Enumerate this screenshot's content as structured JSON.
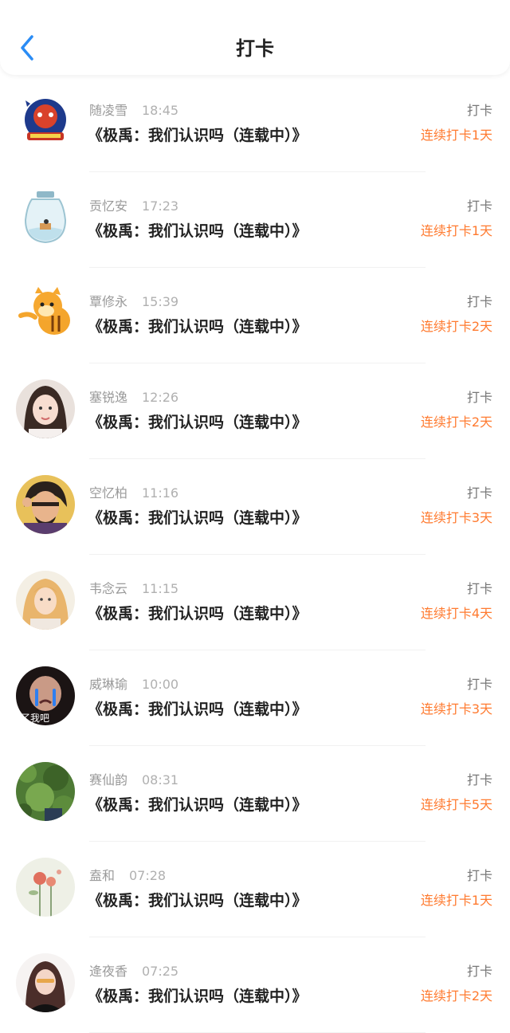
{
  "header": {
    "title": "打卡",
    "back_icon": "chevron-left-icon",
    "accent_color": "#2a8cf5"
  },
  "colors": {
    "streak": "#ff7a2f"
  },
  "items": [
    {
      "name": "随凌雪",
      "time": "18:45",
      "book": "《极禹：我们认识吗（连载中）》",
      "tag": "打卡",
      "streak": "连续打卡1天"
    },
    {
      "name": "贡忆安",
      "time": "17:23",
      "book": "《极禹：我们认识吗（连载中）》",
      "tag": "打卡",
      "streak": "连续打卡1天"
    },
    {
      "name": "覃修永",
      "time": "15:39",
      "book": "《极禹：我们认识吗（连载中）》",
      "tag": "打卡",
      "streak": "连续打卡2天"
    },
    {
      "name": "塞锐逸",
      "time": "12:26",
      "book": "《极禹：我们认识吗（连载中）》",
      "tag": "打卡",
      "streak": "连续打卡2天"
    },
    {
      "name": "空忆柏",
      "time": "11:16",
      "book": "《极禹：我们认识吗（连载中）》",
      "tag": "打卡",
      "streak": "连续打卡3天"
    },
    {
      "name": "韦念云",
      "time": "11:15",
      "book": "《极禹：我们认识吗（连载中）》",
      "tag": "打卡",
      "streak": "连续打卡4天"
    },
    {
      "name": "威琳瑜",
      "time": "10:00",
      "book": "《极禹：我们认识吗（连载中）》",
      "tag": "打卡",
      "streak": "连续打卡3天"
    },
    {
      "name": "赛仙韵",
      "time": "08:31",
      "book": "《极禹：我们认识吗（连载中）》",
      "tag": "打卡",
      "streak": "连续打卡5天"
    },
    {
      "name": "盍和",
      "time": "07:28",
      "book": "《极禹：我们认识吗（连载中）》",
      "tag": "打卡",
      "streak": "连续打卡1天"
    },
    {
      "name": "逄夜香",
      "time": "07:25",
      "book": "《极禹：我们认识吗（连载中）》",
      "tag": "打卡",
      "streak": "连续打卡2天"
    }
  ],
  "avatar_overlay_text": "了我吧"
}
